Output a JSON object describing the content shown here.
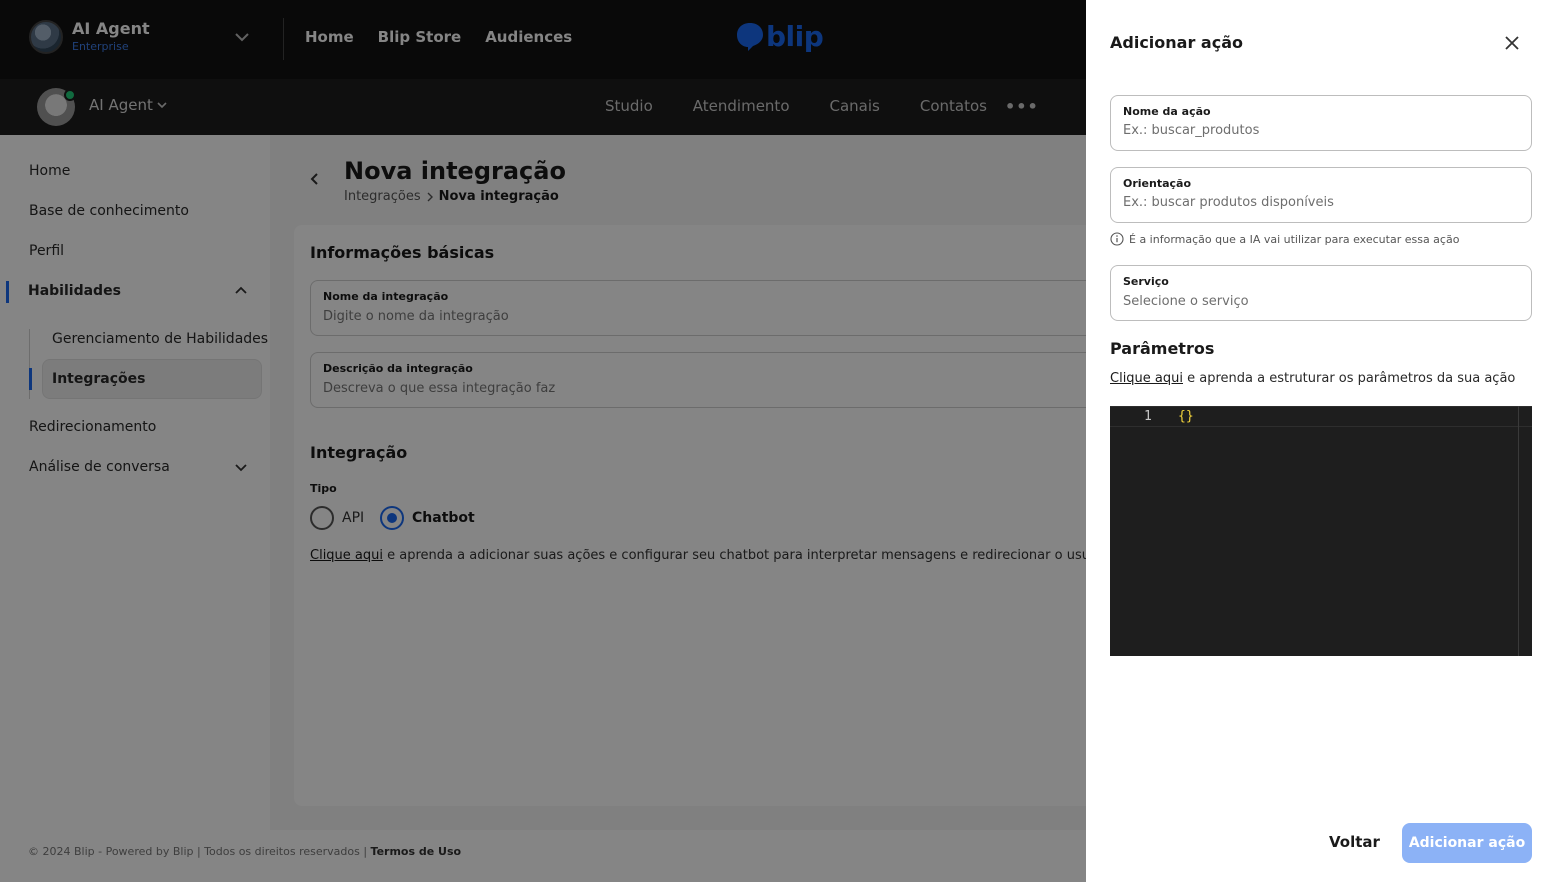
{
  "colors": {
    "primary": "#1968f0",
    "online": "#21cc79",
    "code_brace": "#f2d33b",
    "disabled_button": "#8cb2f6"
  },
  "topbar": {
    "tenant_name": "AI Agent",
    "tenant_plan": "Enterprise",
    "nav": [
      "Home",
      "Blip Store",
      "Audiences"
    ],
    "logo_text": "blip"
  },
  "subbar": {
    "bot_name": "AI Agent",
    "nav": [
      "Studio",
      "Atendimento",
      "Canais",
      "Contatos"
    ],
    "more": "•••"
  },
  "sidebar": {
    "items": {
      "home": "Home",
      "knowledge": "Base de conhecimento",
      "profile": "Perfil",
      "skills": "Habilidades",
      "skills_management": "Gerenciamento de Habilidades",
      "integrations": "Integrações",
      "redirect": "Redirecionamento",
      "analysis": "Análise de conversa"
    }
  },
  "page": {
    "title": "Nova integração",
    "breadcrumb_parent": "Integrações",
    "breadcrumb_current": "Nova integração",
    "basic_info_title": "Informações básicas",
    "name_label": "Nome da integração",
    "name_placeholder": "Digite o nome da integração",
    "desc_label": "Descrição da integração",
    "desc_placeholder": "Descreva o que essa integração faz",
    "integration_title": "Integração",
    "type_label": "Tipo",
    "type_api": "API",
    "type_chatbot": "Chatbot",
    "help_link": "Clique aqui",
    "help_text": " e aprenda a adicionar suas ações e configurar seu chatbot para interpretar mensagens e redirecionar o usuário ao fluxo correto"
  },
  "footer": {
    "text": "© 2024 Blip - Powered by Blip | Todos os direitos reservados | ",
    "terms": "Termos de Uso"
  },
  "drawer": {
    "title": "Adicionar ação",
    "action_name_label": "Nome da ação",
    "action_name_placeholder": "Ex.: buscar_produtos",
    "orientation_label": "Orientação",
    "orientation_placeholder": "Ex.: buscar produtos disponíveis",
    "orientation_hint": "É a informação que a IA vai utilizar para executar essa ação",
    "service_label": "Serviço",
    "service_placeholder": "Selecione o serviço",
    "params_title": "Parâmetros",
    "params_link": "Clique aqui",
    "params_text": " e aprenda a estruturar os parâmetros da sua ação",
    "editor_line_number": "1",
    "editor_code": "{}",
    "back_button": "Voltar",
    "add_button": "Adicionar ação"
  }
}
